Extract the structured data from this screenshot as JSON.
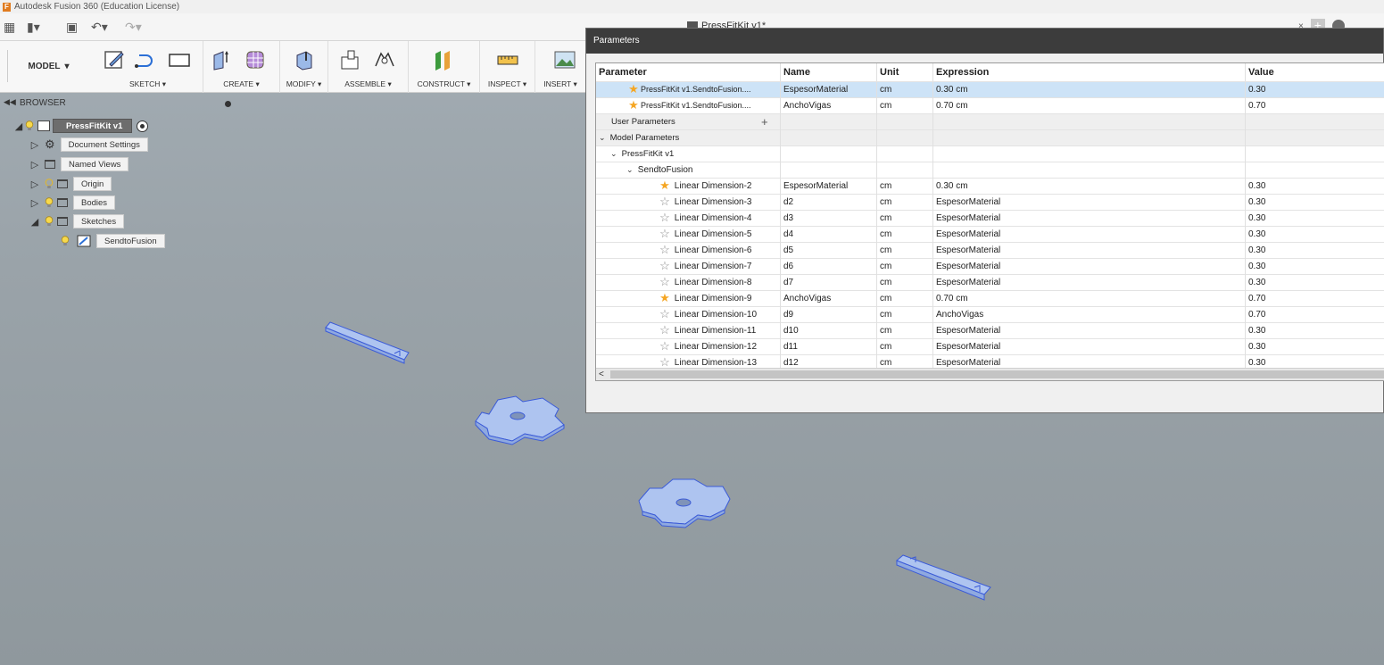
{
  "window": {
    "title": "Autodesk Fusion 360 (Education License)"
  },
  "document_tab": {
    "title": "PressFitKit v1*"
  },
  "toolbar": {
    "workspace": "MODEL",
    "groups": [
      "SKETCH",
      "CREATE",
      "MODIFY",
      "ASSEMBLE",
      "CONSTRUCT",
      "INSPECT",
      "INSERT"
    ]
  },
  "browser": {
    "title": "BROWSER",
    "root": "PressFitKit v1",
    "items": [
      "Document Settings",
      "Named Views",
      "Origin",
      "Bodies",
      "Sketches"
    ],
    "sketch": "SendtoFusion"
  },
  "dialog": {
    "title": "Parameters",
    "headers": {
      "parameter": "Parameter",
      "name": "Name",
      "unit": "Unit",
      "expression": "Expression",
      "value": "Value"
    },
    "favorites": [
      {
        "parameter": "PressFitKit v1.SendtoFusion....",
        "name": "EspesorMaterial",
        "unit": "cm",
        "expression": "0.30 cm",
        "value": "0.30"
      },
      {
        "parameter": "PressFitKit v1.SendtoFusion....",
        "name": "AnchoVigas",
        "unit": "cm",
        "expression": "0.70 cm",
        "value": "0.70"
      }
    ],
    "user_parameters": "User Parameters",
    "model_parameters": "Model Parameters",
    "component": "PressFitKit v1",
    "sketch": "SendtoFusion",
    "dimensions": [
      {
        "parameter": "Linear Dimension-2",
        "starred": true,
        "name": "EspesorMaterial",
        "unit": "cm",
        "expression": "0.30 cm",
        "value": "0.30"
      },
      {
        "parameter": "Linear Dimension-3",
        "starred": false,
        "name": "d2",
        "unit": "cm",
        "expression": "EspesorMaterial",
        "value": "0.30"
      },
      {
        "parameter": "Linear Dimension-4",
        "starred": false,
        "name": "d3",
        "unit": "cm",
        "expression": "EspesorMaterial",
        "value": "0.30"
      },
      {
        "parameter": "Linear Dimension-5",
        "starred": false,
        "name": "d4",
        "unit": "cm",
        "expression": "EspesorMaterial",
        "value": "0.30"
      },
      {
        "parameter": "Linear Dimension-6",
        "starred": false,
        "name": "d5",
        "unit": "cm",
        "expression": "EspesorMaterial",
        "value": "0.30"
      },
      {
        "parameter": "Linear Dimension-7",
        "starred": false,
        "name": "d6",
        "unit": "cm",
        "expression": "EspesorMaterial",
        "value": "0.30"
      },
      {
        "parameter": "Linear Dimension-8",
        "starred": false,
        "name": "d7",
        "unit": "cm",
        "expression": "EspesorMaterial",
        "value": "0.30"
      },
      {
        "parameter": "Linear Dimension-9",
        "starred": true,
        "name": "AnchoVigas",
        "unit": "cm",
        "expression": "0.70 cm",
        "value": "0.70"
      },
      {
        "parameter": "Linear Dimension-10",
        "starred": false,
        "name": "d9",
        "unit": "cm",
        "expression": "AnchoVigas",
        "value": "0.70"
      },
      {
        "parameter": "Linear Dimension-11",
        "starred": false,
        "name": "d10",
        "unit": "cm",
        "expression": "EspesorMaterial",
        "value": "0.30"
      },
      {
        "parameter": "Linear Dimension-12",
        "starred": false,
        "name": "d11",
        "unit": "cm",
        "expression": "EspesorMaterial",
        "value": "0.30"
      },
      {
        "parameter": "Linear Dimension-13",
        "starred": false,
        "name": "d12",
        "unit": "cm",
        "expression": "EspesorMaterial",
        "value": "0.30"
      }
    ]
  },
  "colors": {
    "accent": "#f5a623",
    "selection": "#cde3f7",
    "part_fill": "#a9c1ee",
    "part_edge": "#3b5bd8"
  }
}
